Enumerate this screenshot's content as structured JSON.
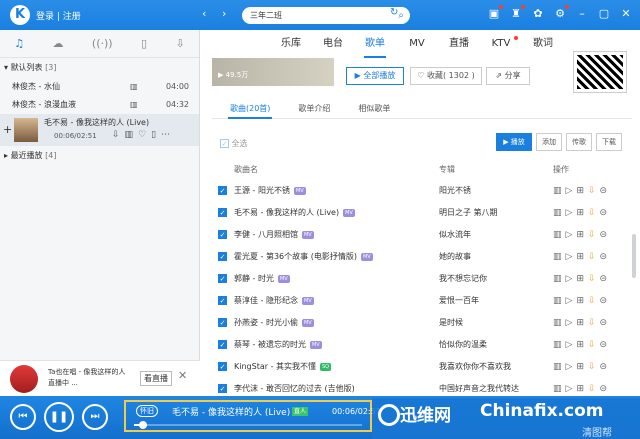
{
  "topbar": {
    "logo": "K",
    "login": "登录 | 注册",
    "back": "‹",
    "forward": "›",
    "search_text": "三年二班",
    "icons": [
      "game-icon",
      "clothes-icon",
      "skin-icon",
      "gear-icon",
      "minimize-icon",
      "maximize-icon",
      "close-icon"
    ]
  },
  "left": {
    "tabs": [
      "♫",
      "☁",
      "((·))",
      "▯",
      "⇩"
    ],
    "group_default": "默认列表",
    "group_default_count": "[3]",
    "songs": [
      {
        "title": "林俊杰 - 水仙",
        "dur": "04:00"
      },
      {
        "title": "林俊杰 - 浪漫血液",
        "dur": "04:32"
      }
    ],
    "current": {
      "title": "毛不易 - 像我这样的人 (Live)",
      "progress": "00:06/02:51"
    },
    "group_recent": "最近播放",
    "group_recent_count": "[4]",
    "live_card": {
      "line1": "Ta也在唱 - 像我这样的人",
      "line2": "直播中 ...",
      "button": "看直播"
    }
  },
  "main_nav": [
    "乐库",
    "电台",
    "歌单",
    "MV",
    "直播",
    "KTV",
    "歌词"
  ],
  "banner": {
    "plays": "▶ 49.5万"
  },
  "actions": {
    "play_all": "▶ 全部播放",
    "favorite": "♡ 收藏( 1302 )",
    "share": "⇗ 分享"
  },
  "sub_tabs": [
    "歌曲(20首)",
    "歌单介绍",
    "相似歌单"
  ],
  "toolbar": {
    "select_all": "全选",
    "play": "▶ 播放",
    "add": "添加",
    "send": "传歌",
    "download": "下载"
  },
  "table": {
    "headers": {
      "title": "歌曲名",
      "album": "专辑",
      "ops": "操作"
    },
    "rows": [
      {
        "title": "王源 - 阳光不锈",
        "tag": "MV",
        "album": "阳光不锈"
      },
      {
        "title": "毛不易 - 像我这样的人 (Live)",
        "tag": "MV",
        "album": "明日之子 第八期"
      },
      {
        "title": "李健 - 八月照相馆",
        "tag": "MV",
        "album": "似水流年"
      },
      {
        "title": "霍光夏 - 第36个故事 (电影抒情版)",
        "tag": "MV",
        "album": "她的故事"
      },
      {
        "title": "郭静 - 时光",
        "tag": "MV",
        "album": "我不想忘记你"
      },
      {
        "title": "蔡淳佳 - 隐形纪念",
        "tag": "MV",
        "album": "爱恨一百年"
      },
      {
        "title": "孙燕姿 - 时光小偷",
        "tag": "MV",
        "album": "是时候"
      },
      {
        "title": "蔡琴 - 被遗忘的时光",
        "tag": "MV",
        "album": "恰似你的温柔"
      },
      {
        "title": "KingStar - 其实我不懂",
        "tag": "SQ",
        "album": "我喜欢你你不喜欢我"
      },
      {
        "title": "李代沫 - 敢否回忆的过去 (吉他版)",
        "tag": "",
        "album": "中国好声音之我代转达"
      }
    ]
  },
  "player": {
    "mode": "怀旧",
    "title": "毛不易 - 像我这样的人 (Live)",
    "badge": "直人",
    "time": "00:06/02:51",
    "progress": 0.04
  },
  "watermark": {
    "text1": "迅维网",
    "text2": "Chinafix.com",
    "text3": "清图帮"
  }
}
